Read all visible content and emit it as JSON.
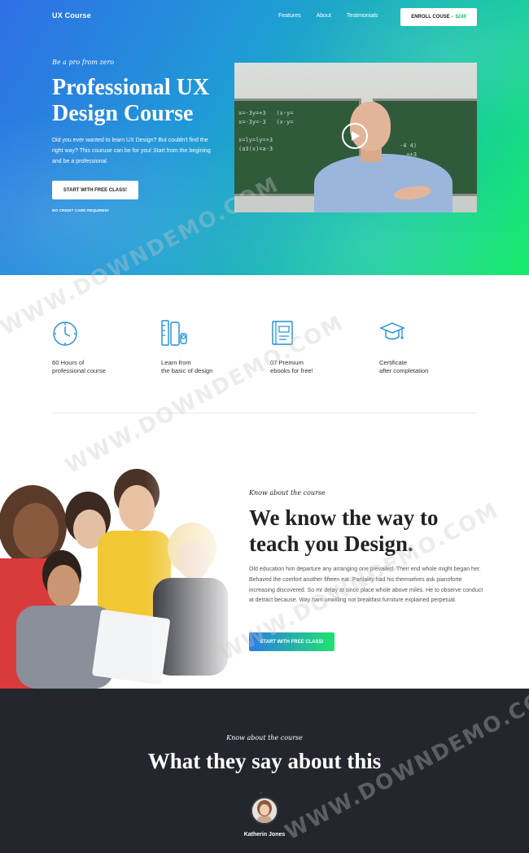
{
  "header": {
    "brand": "UX Course",
    "nav": [
      "Features",
      "About",
      "Testimonials"
    ],
    "enroll_label": "ENROLL COUSE -",
    "enroll_price": "$249"
  },
  "hero": {
    "tagline": "Be a pro from zero",
    "title": "Professional UX Design Course",
    "description": "Did you ever wanted to learn UX Design? But couldn't find the right way? This couruse can be for you! Start from the begining and be a professional",
    "cta": "START WITH FREE CLASS!",
    "note": "NO CREDIT CARD REQUIRED!"
  },
  "features": [
    {
      "icon": "clock-icon",
      "text": "60 Hours of\nprofessional course"
    },
    {
      "icon": "design-tools-icon",
      "text": "Learn from\nthe basic of design"
    },
    {
      "icon": "ebook-icon",
      "text": "07 Premium\nebooks for free!"
    },
    {
      "icon": "graduation-cap-icon",
      "text": "Certificate\nafter completation"
    }
  ],
  "about": {
    "tagline": "Know about the course",
    "title": "We know the way to teach you Design.",
    "description": "Old education him departure any arranging one prevailed. Their end whole might began her. Behaved the comfort another fifteen eat. Partiality had his themselves ask pianoforte increasing discovered. So mr delay at since place whole above miles. He to observe conduct at detract because. Way ham unwilling not breakfast furniture explained perpetual.",
    "cta": "START WITH FREE CLASS!"
  },
  "testimonials": {
    "tagline": "Know about the course",
    "title": "What they say about this",
    "name": "Katherin Jones"
  },
  "watermark": "WWW.DOWNDEMO.COM",
  "colors": {
    "gradient_start": "#2f6fe6",
    "gradient_end": "#18ec6a",
    "dark_bg": "#23262d",
    "accent": "#1e9fd8",
    "price": "#1cc96a"
  }
}
